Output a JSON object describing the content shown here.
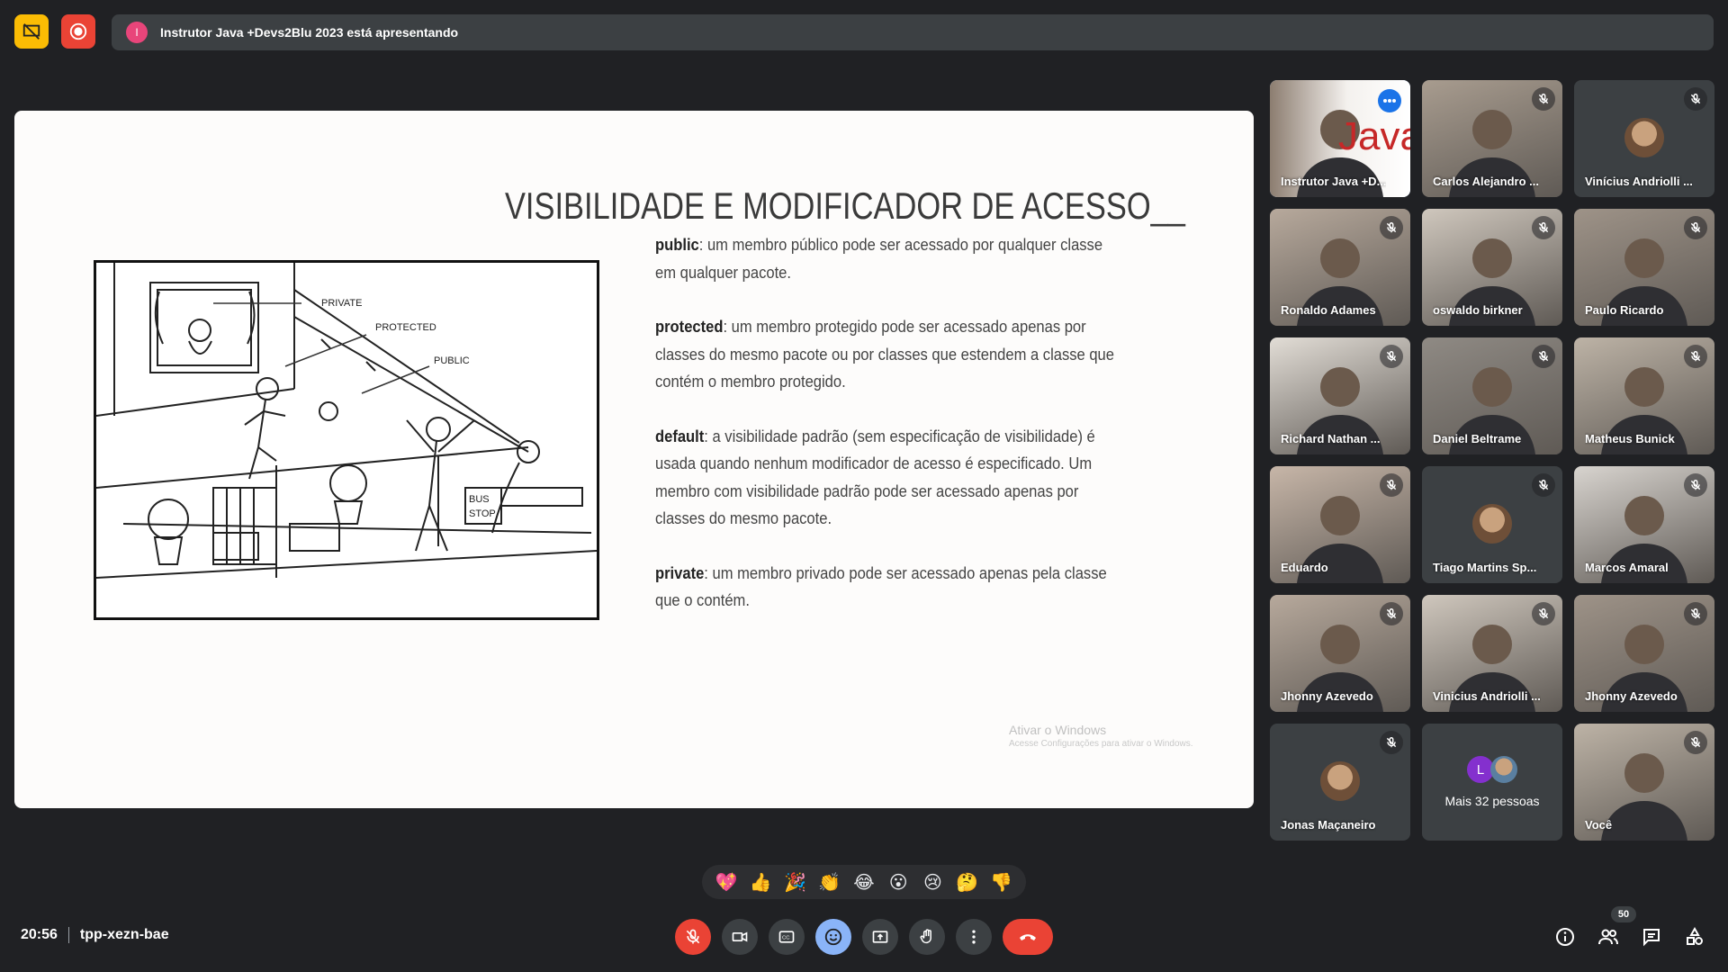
{
  "colors": {
    "background": "#202124",
    "tile": "#3c4043",
    "danger": "#ea4335",
    "accent": "#8ab4f8",
    "presenter": "#e8457a"
  },
  "presenting_banner": {
    "initial": "I",
    "text": "Instrutor Java +Devs2Blu 2023 está apresentando"
  },
  "slide": {
    "title": "VISIBILIDADE E MODIFICADOR DE ACESSO__",
    "cartoon_labels": {
      "private": "PRIVATE",
      "protected": "PROTECTED",
      "public": "PUBLIC",
      "bus_stop_1": "BUS",
      "bus_stop_2": "STOP"
    },
    "items": [
      {
        "keyword": "public",
        "text": ": um membro público pode ser acessado por qualquer classe em qualquer pacote."
      },
      {
        "keyword": "protected",
        "text": ": um membro protegido pode ser acessado apenas por classes do mesmo pacote ou por classes que estendem a classe que contém o membro protegido."
      },
      {
        "keyword": "default",
        "text": ": a visibilidade padrão (sem especificação de visibilidade) é usada quando nenhum modificador de acesso é especificado. Um membro com visibilidade padrão pode ser acessado apenas por classes do mesmo pacote."
      },
      {
        "keyword": "private",
        "text": ": um membro privado pode ser acessado apenas pela classe que o contém."
      }
    ],
    "watermark_title": "Ativar o Windows",
    "watermark_sub": "Acesse Configurações para ativar o Windows."
  },
  "participants": [
    {
      "name": "Instrutor Java +D...",
      "kind": "video-java",
      "muted": false
    },
    {
      "name": "Carlos Alejandro ...",
      "kind": "video",
      "muted": true
    },
    {
      "name": "Vinícius Andriolli ...",
      "kind": "avatar",
      "muted": true
    },
    {
      "name": "Ronaldo Adames",
      "kind": "video",
      "muted": true
    },
    {
      "name": "oswaldo birkner",
      "kind": "video",
      "muted": true
    },
    {
      "name": "Paulo Ricardo",
      "kind": "video",
      "muted": true
    },
    {
      "name": "Richard Nathan ...",
      "kind": "video",
      "muted": true
    },
    {
      "name": "Daniel Beltrame",
      "kind": "video",
      "muted": true
    },
    {
      "name": "Matheus Bunick",
      "kind": "video",
      "muted": true
    },
    {
      "name": "Eduardo",
      "kind": "video",
      "muted": true
    },
    {
      "name": "Tiago Martins Sp...",
      "kind": "avatar",
      "muted": true
    },
    {
      "name": "Marcos Amaral",
      "kind": "video",
      "muted": true
    },
    {
      "name": "Jhonny Azevedo",
      "kind": "video",
      "muted": true
    },
    {
      "name": "Vinicius Andriolli ...",
      "kind": "video",
      "muted": true
    },
    {
      "name": "Jhonny Azevedo",
      "kind": "video",
      "muted": true
    },
    {
      "name": "Jonas Maçaneiro",
      "kind": "avatar",
      "muted": true
    },
    {
      "name": "Mais 32 pessoas",
      "kind": "more",
      "muted": false,
      "initial": "L"
    },
    {
      "name": "Você",
      "kind": "video",
      "muted": true
    }
  ],
  "reactions": [
    "💖",
    "👍",
    "🎉",
    "👏",
    "😂",
    "😮",
    "😢",
    "🤔",
    "👎"
  ],
  "meeting": {
    "time": "20:56",
    "code": "tpp-xezn-bae"
  },
  "controls": {
    "mic": "mic-off-icon",
    "camera": "camera-icon",
    "captions": "captions-icon",
    "emoji": "emoji-icon",
    "present": "present-icon",
    "raise_hand": "hand-icon",
    "more": "more-icon",
    "end_call": "end-call-icon"
  },
  "people_count": "50"
}
